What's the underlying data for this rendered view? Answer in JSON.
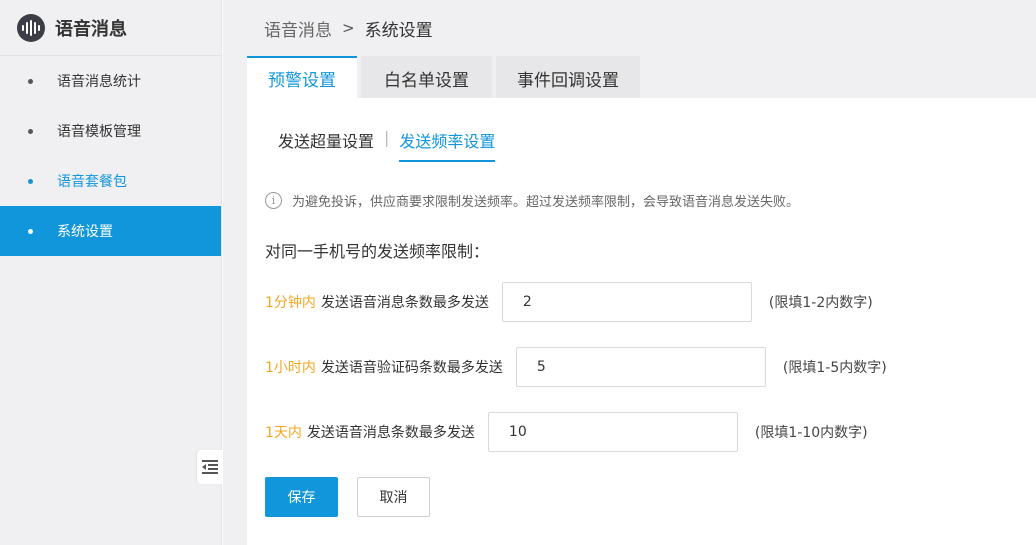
{
  "app": {
    "title": "语音消息"
  },
  "sidebar": {
    "items": [
      {
        "label": "语音消息统计"
      },
      {
        "label": "语音模板管理"
      },
      {
        "label": "语音套餐包"
      },
      {
        "label": "系统设置"
      }
    ]
  },
  "breadcrumb": {
    "root": "语音消息",
    "separator": ">",
    "current": "系统设置"
  },
  "tabs": [
    {
      "label": "预警设置"
    },
    {
      "label": "白名单设置"
    },
    {
      "label": "事件回调设置"
    }
  ],
  "subtabs": [
    {
      "label": "发送超量设置"
    },
    {
      "label": "发送频率设置"
    }
  ],
  "subtab_separator": "|",
  "notice": {
    "icon": "info-icon",
    "text": "为避免投诉，供应商要求限制发送频率。超过发送频率限制，会导致语音消息发送失败。"
  },
  "section_title": "对同一手机号的发送频率限制：",
  "limits": [
    {
      "prefix": "1分钟内",
      "label": "发送语音消息条数最多发送",
      "value": "2",
      "hint": "(限填1-2内数字)"
    },
    {
      "prefix": "1小时内",
      "label": "发送语音验证码条数最多发送",
      "value": "5",
      "hint": "(限填1-5内数字)"
    },
    {
      "prefix": "1天内",
      "label": "发送语音消息条数最多发送",
      "value": "10",
      "hint": "(限填1-10内数字)"
    }
  ],
  "buttons": {
    "save": "保存",
    "cancel": "取消"
  },
  "colors": {
    "accent": "#1296db",
    "warning": "#f5a623",
    "sidebar_bg": "#f0f0f3"
  }
}
